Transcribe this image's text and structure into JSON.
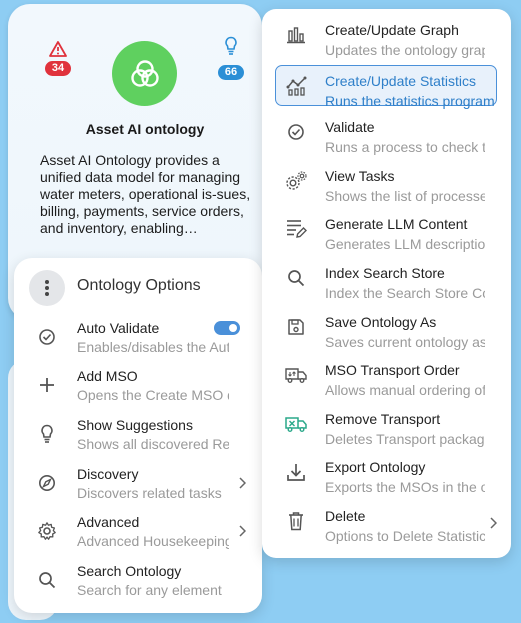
{
  "card": {
    "alert_count": "34",
    "suggestion_count": "66",
    "title": "Asset AI ontology",
    "description": "Asset AI Ontology provides a unified data model for managing water meters, operational is-sues, billing, payments, service orders, and inventory, enabling…",
    "colors": {
      "logo": "#5fd05f",
      "alert": "#e0323c",
      "suggestion": "#2b8fd6"
    }
  },
  "options": {
    "title": "Ontology Options",
    "items": [
      {
        "label": "Auto Validate",
        "sub": "Enables/disables the Auto Validate",
        "icon": "check-circle-icon",
        "toggle_on": true
      },
      {
        "label": "Add MSO",
        "sub": "Opens the Create MSO dialog",
        "icon": "plus-icon"
      },
      {
        "label": "Show Suggestions",
        "sub": "Shows all discovered Relations",
        "icon": "lightbulb-icon"
      },
      {
        "label": "Discovery",
        "sub": "Discovers related tasks",
        "icon": "compass-icon",
        "submenu": true
      },
      {
        "label": "Advanced",
        "sub": "Advanced Housekeeping",
        "icon": "gear-icon",
        "submenu": true
      },
      {
        "label": "Search Ontology",
        "sub": "Search for any element",
        "icon": "search-icon"
      }
    ]
  },
  "menu": {
    "items": [
      {
        "label": "Create/Update Graph",
        "sub": "Updates the ontology graph",
        "icon": "bar-chart-icon"
      },
      {
        "label": "Create/Update Statistics",
        "sub": "Runs the statistics program",
        "icon": "line-chart-icon",
        "active": true
      },
      {
        "label": "Validate",
        "sub": "Runs a process to check the ontology",
        "icon": "check-circle-icon"
      },
      {
        "label": "View Tasks",
        "sub": "Shows the list of processes",
        "icon": "gears-icon"
      },
      {
        "label": "Generate LLM Content",
        "sub": "Generates LLM descriptions",
        "icon": "document-edit-icon"
      },
      {
        "label": "Index Search Store",
        "sub": "Index the Search Store Content",
        "icon": "search-icon"
      },
      {
        "label": "Save Ontology As",
        "sub": "Saves current ontology as",
        "icon": "save-icon"
      },
      {
        "label": "MSO Transport Order",
        "sub": "Allows manual ordering of MSOs",
        "icon": "truck-outline-icon"
      },
      {
        "label": "Remove Transport",
        "sub": "Deletes Transport packages",
        "icon": "truck-remove-icon"
      },
      {
        "label": "Export Ontology",
        "sub": "Exports the MSOs in the ontology",
        "icon": "download-icon"
      },
      {
        "label": "Delete",
        "sub": "Options to Delete Statistics",
        "icon": "trash-icon",
        "submenu": true
      }
    ]
  }
}
